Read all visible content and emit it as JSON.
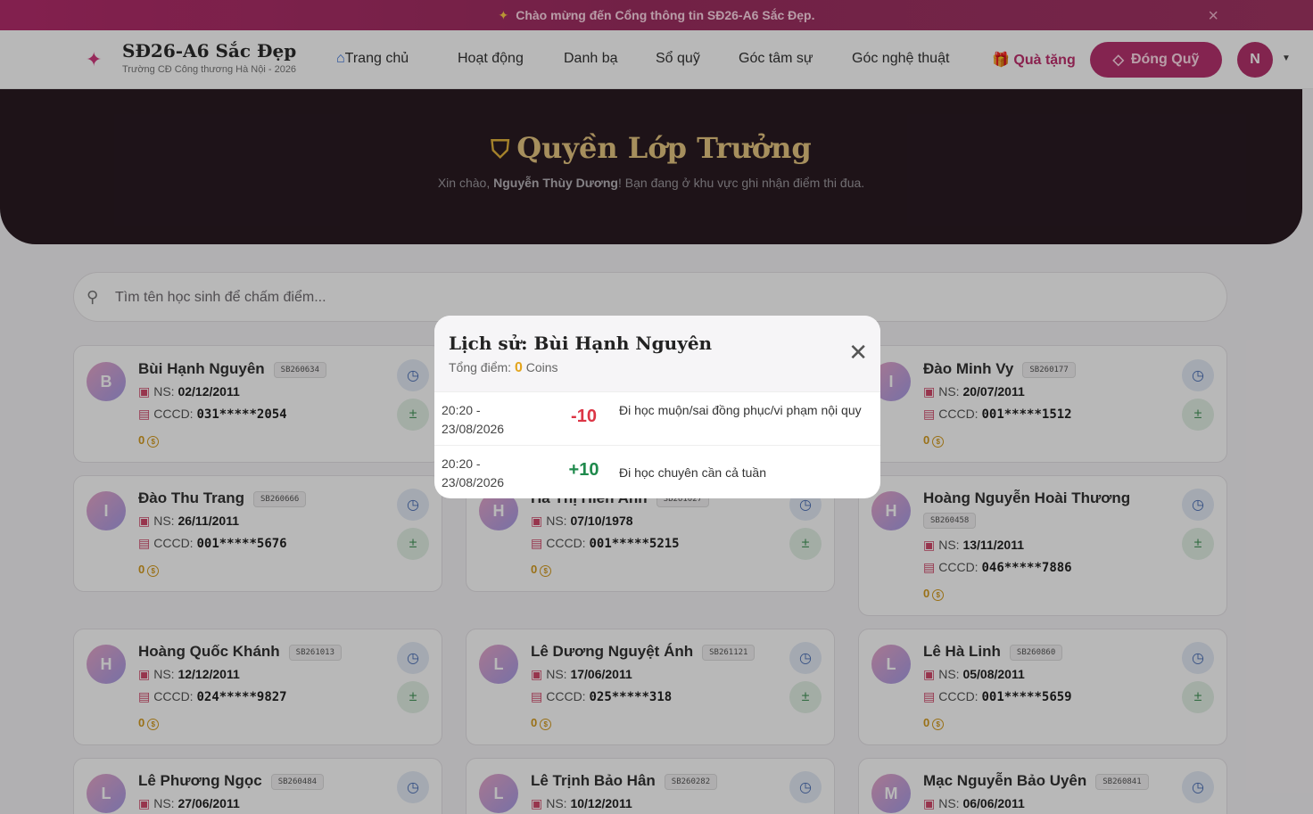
{
  "announcement": {
    "text": "Chào mừng đến Cổng thông tin SĐ26-A6 Sắc Đẹp.",
    "close": "×"
  },
  "brand": {
    "title": "SĐ26-A6 Sắc Đẹp",
    "subtitle": "Trường CĐ Công thương Hà Nội - 2026"
  },
  "nav": {
    "links": [
      "Trang chủ",
      "Hoạt động",
      "Danh bạ",
      "Sổ quỹ",
      "Góc tâm sự",
      "Góc nghệ thuật"
    ],
    "gift": "Quà tặng",
    "donate_button": "Đóng Quỹ",
    "avatar_initial": "N"
  },
  "hero": {
    "title": "Quyền Lớp Trưởng",
    "greeting_prefix": "Xin chào,",
    "user_name": "Nguyễn Thùy Dương",
    "greeting_suffix": "! Bạn đang ở khu vực ghi nhận điểm thi đua."
  },
  "search": {
    "placeholder": "Tìm tên học sinh để chấm điểm..."
  },
  "labels": {
    "dob": "NS:",
    "id": "CCCD:"
  },
  "students": [
    {
      "initial": "B",
      "name": "Bùi Hạnh Nguyên",
      "code": "SB260634",
      "dob": "02/12/2011",
      "cccd": "031*****2054",
      "coins": "0"
    },
    {
      "initial": "",
      "name": "",
      "code": "",
      "dob": "",
      "cccd": "",
      "coins": ""
    },
    {
      "initial": "I",
      "name": "Đào Minh Vy",
      "code": "SB260177",
      "dob": "20/07/2011",
      "cccd": "001*****1512",
      "coins": "0"
    },
    {
      "initial": "I",
      "name": "Đào Thu Trang",
      "code": "SB260666",
      "dob": "26/11/2011",
      "cccd": "001*****5676",
      "coins": "0"
    },
    {
      "initial": "H",
      "name": "Hà Thị Hiền Anh",
      "code": "SB261027",
      "dob": "07/10/1978",
      "cccd": "001*****5215",
      "coins": "0"
    },
    {
      "initial": "H",
      "name": "Hoàng Nguyễn Hoài Thương",
      "code": "SB260458",
      "dob": "13/11/2011",
      "cccd": "046*****7886",
      "coins": "0"
    },
    {
      "initial": "H",
      "name": "Hoàng Quốc Khánh",
      "code": "SB261013",
      "dob": "12/12/2011",
      "cccd": "024*****9827",
      "coins": "0"
    },
    {
      "initial": "L",
      "name": "Lê Dương Nguyệt Ánh",
      "code": "SB261121",
      "dob": "17/06/2011",
      "cccd": "025*****318",
      "coins": "0"
    },
    {
      "initial": "L",
      "name": "Lê Hà Linh",
      "code": "SB260860",
      "dob": "05/08/2011",
      "cccd": "001*****5659",
      "coins": "0"
    },
    {
      "initial": "L",
      "name": "Lê Phương Ngọc",
      "code": "SB260484",
      "dob": "27/06/2011",
      "cccd": "",
      "coins": ""
    },
    {
      "initial": "L",
      "name": "Lê Trịnh Bảo Hân",
      "code": "SB260282",
      "dob": "10/12/2011",
      "cccd": "",
      "coins": ""
    },
    {
      "initial": "M",
      "name": "Mạc Nguyễn Bảo Uyên",
      "code": "SB260841",
      "dob": "06/06/2011",
      "cccd": "",
      "coins": ""
    }
  ],
  "modal": {
    "title": "Lịch sử: Bùi Hạnh Nguyên",
    "total_label": "Tổng điểm:",
    "total_value": "0",
    "total_unit": "Coins",
    "history": [
      {
        "time": "20:20 -",
        "date": "23/08/2026",
        "points": "-10",
        "reason": "Đi học muộn/sai đồng phục/vi phạm nội quy"
      },
      {
        "time": "20:20 -",
        "date": "23/08/2026",
        "points": "+10",
        "reason": "Đi học chuyên cần cả tuần"
      }
    ]
  },
  "colors": {
    "accent": "#b8326f",
    "hero_bg": "#2a1b22",
    "gold": "#e7c681",
    "negative": "#dc3545",
    "positive": "#1f8a4c"
  }
}
